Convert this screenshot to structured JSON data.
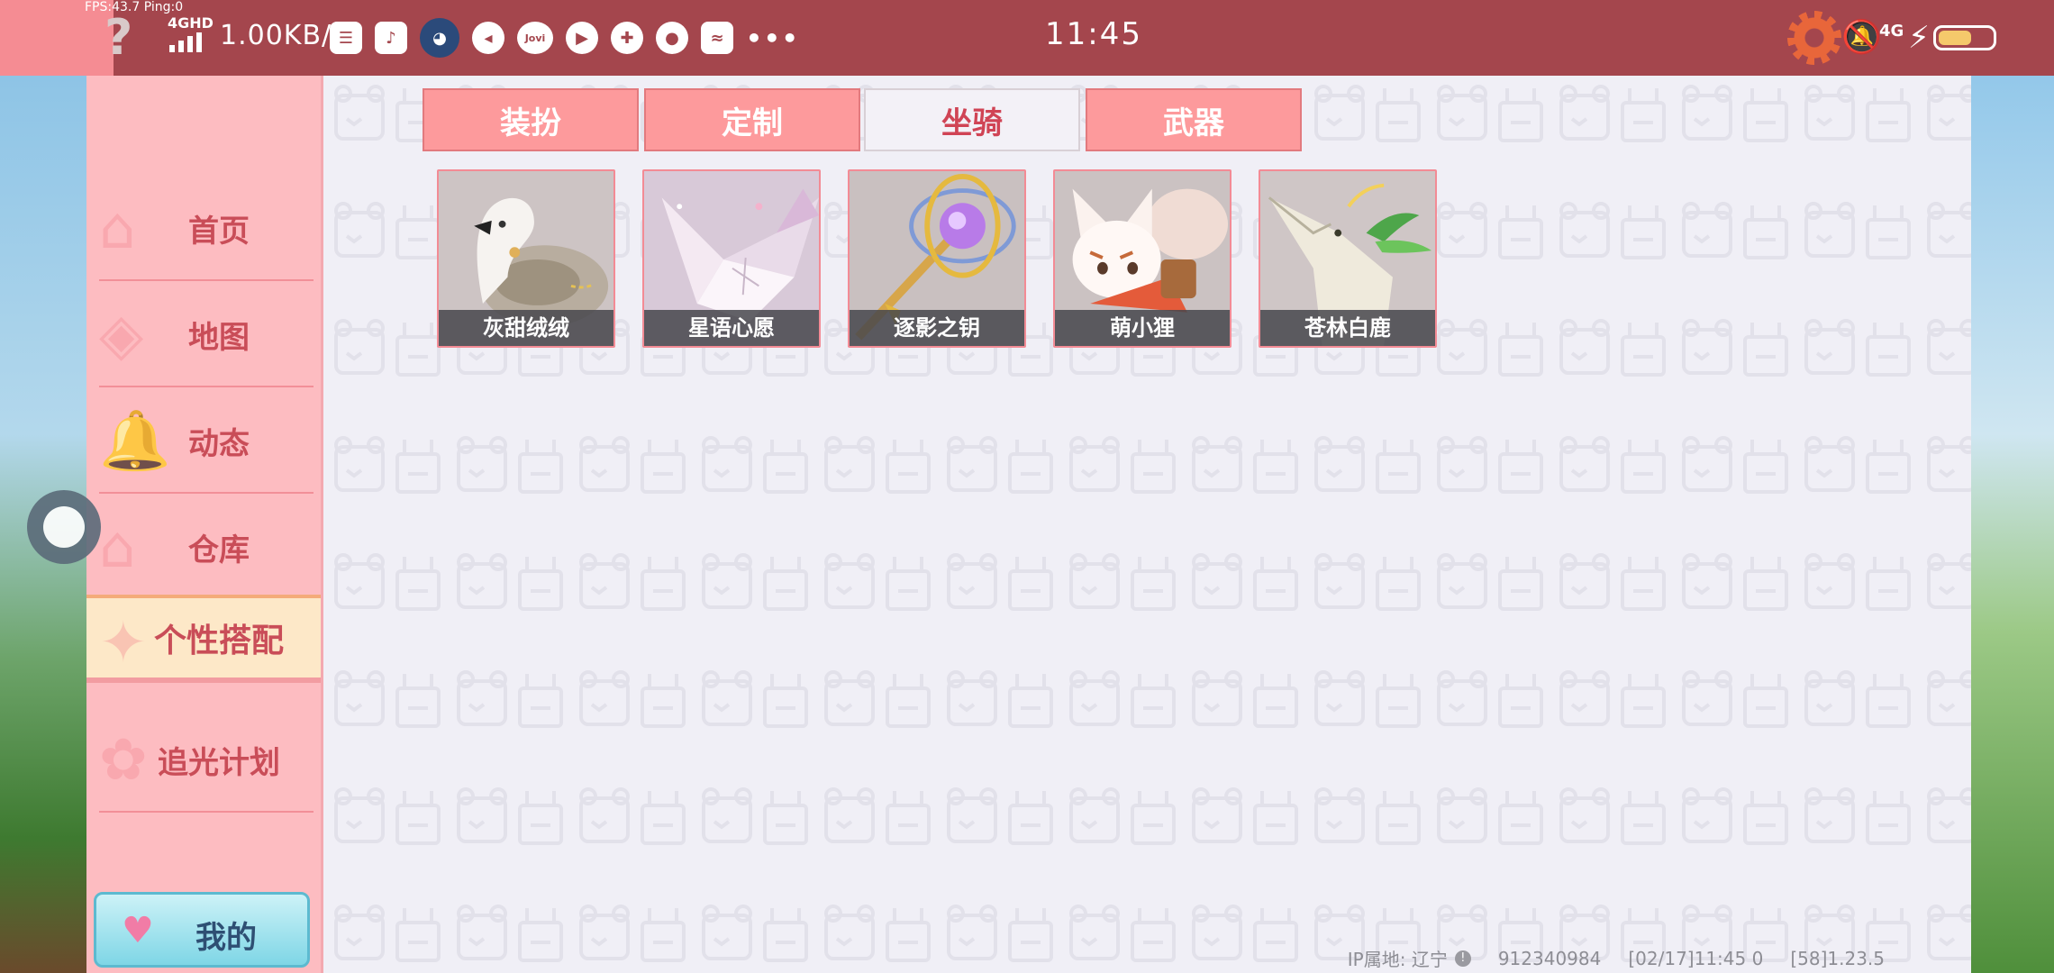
{
  "status_bar": {
    "fps_text": "FPS:43.7  Ping:0",
    "network_type": "4GHD",
    "speed": "1.00KB/s",
    "time": "11:45",
    "network_type_right": "4G",
    "battery_level": 0.62
  },
  "sidebar": {
    "items": [
      {
        "label": "首页"
      },
      {
        "label": "地图"
      },
      {
        "label": "动态"
      },
      {
        "label": "仓库"
      },
      {
        "label": "个性搭配"
      },
      {
        "label": "追光计划"
      }
    ],
    "active_index": 4,
    "my_button_label": "我的"
  },
  "tabs": [
    {
      "label": "装扮"
    },
    {
      "label": "定制"
    },
    {
      "label": "坐骑"
    },
    {
      "label": "武器"
    }
  ],
  "active_tab_index": 2,
  "items": [
    {
      "name": "灰甜绒绒"
    },
    {
      "name": "星语心愿"
    },
    {
      "name": "逐影之钥"
    },
    {
      "name": "萌小狸"
    },
    {
      "name": "苍林白鹿"
    }
  ],
  "footer": {
    "ip_location": "IP属地: 辽宁",
    "user_id": "912340984",
    "timestamp": "[02/17]11:45 0",
    "version": "[58]1.23.5"
  }
}
